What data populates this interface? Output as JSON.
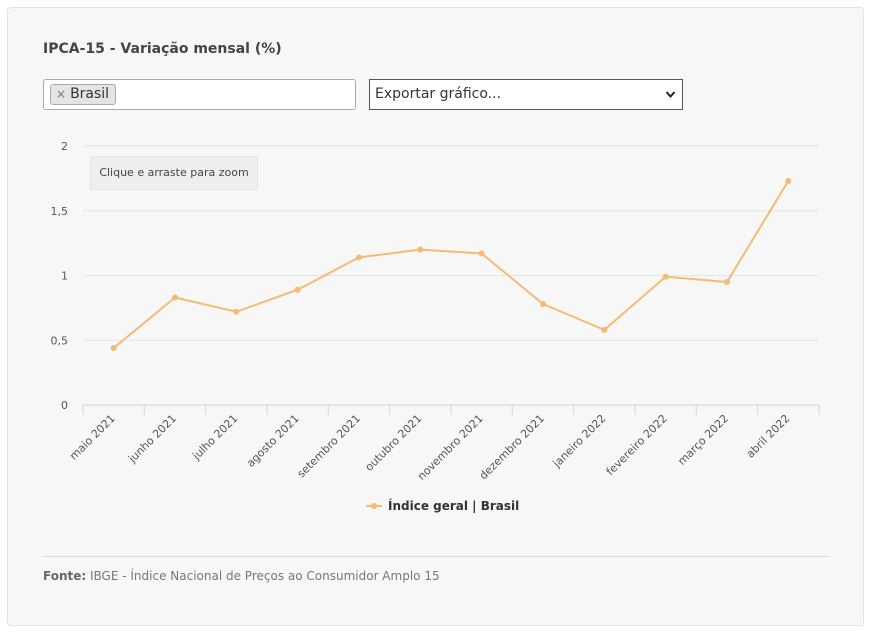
{
  "card": {
    "title": "IPCA-15 - Variação mensal (%)",
    "tag_label": "Brasil",
    "tag_remove": "×",
    "export_select": "Exportar gráfico..."
  },
  "zoom_hint": "Clique e arraste para zoom",
  "legend_label": "Índice geral | Brasil",
  "source_prefix": "Fonte:",
  "source_text": " IBGE - Índice Nacional de Preços ao Consumidor Amplo 15",
  "colors": {
    "series": "#f2bc74",
    "grid": "#e6e6e6",
    "axis": "#ccd6eb"
  },
  "chart_data": {
    "type": "line",
    "categories": [
      "maio 2021",
      "junho 2021",
      "julho 2021",
      "agosto 2021",
      "setembro 2021",
      "outubro 2021",
      "novembro 2021",
      "dezembro 2021",
      "janeiro 2022",
      "fevereiro 2022",
      "março 2022",
      "abril 2022"
    ],
    "series": [
      {
        "name": "Índice geral | Brasil",
        "values": [
          0.44,
          0.83,
          0.72,
          0.89,
          1.14,
          1.2,
          1.17,
          0.78,
          0.58,
          0.99,
          0.95,
          1.73
        ]
      }
    ],
    "ylim": [
      0,
      2
    ],
    "yticks": [
      "0",
      "0,5",
      "1",
      "1,5",
      "2"
    ],
    "grid": true,
    "legend": "bottom-center"
  }
}
